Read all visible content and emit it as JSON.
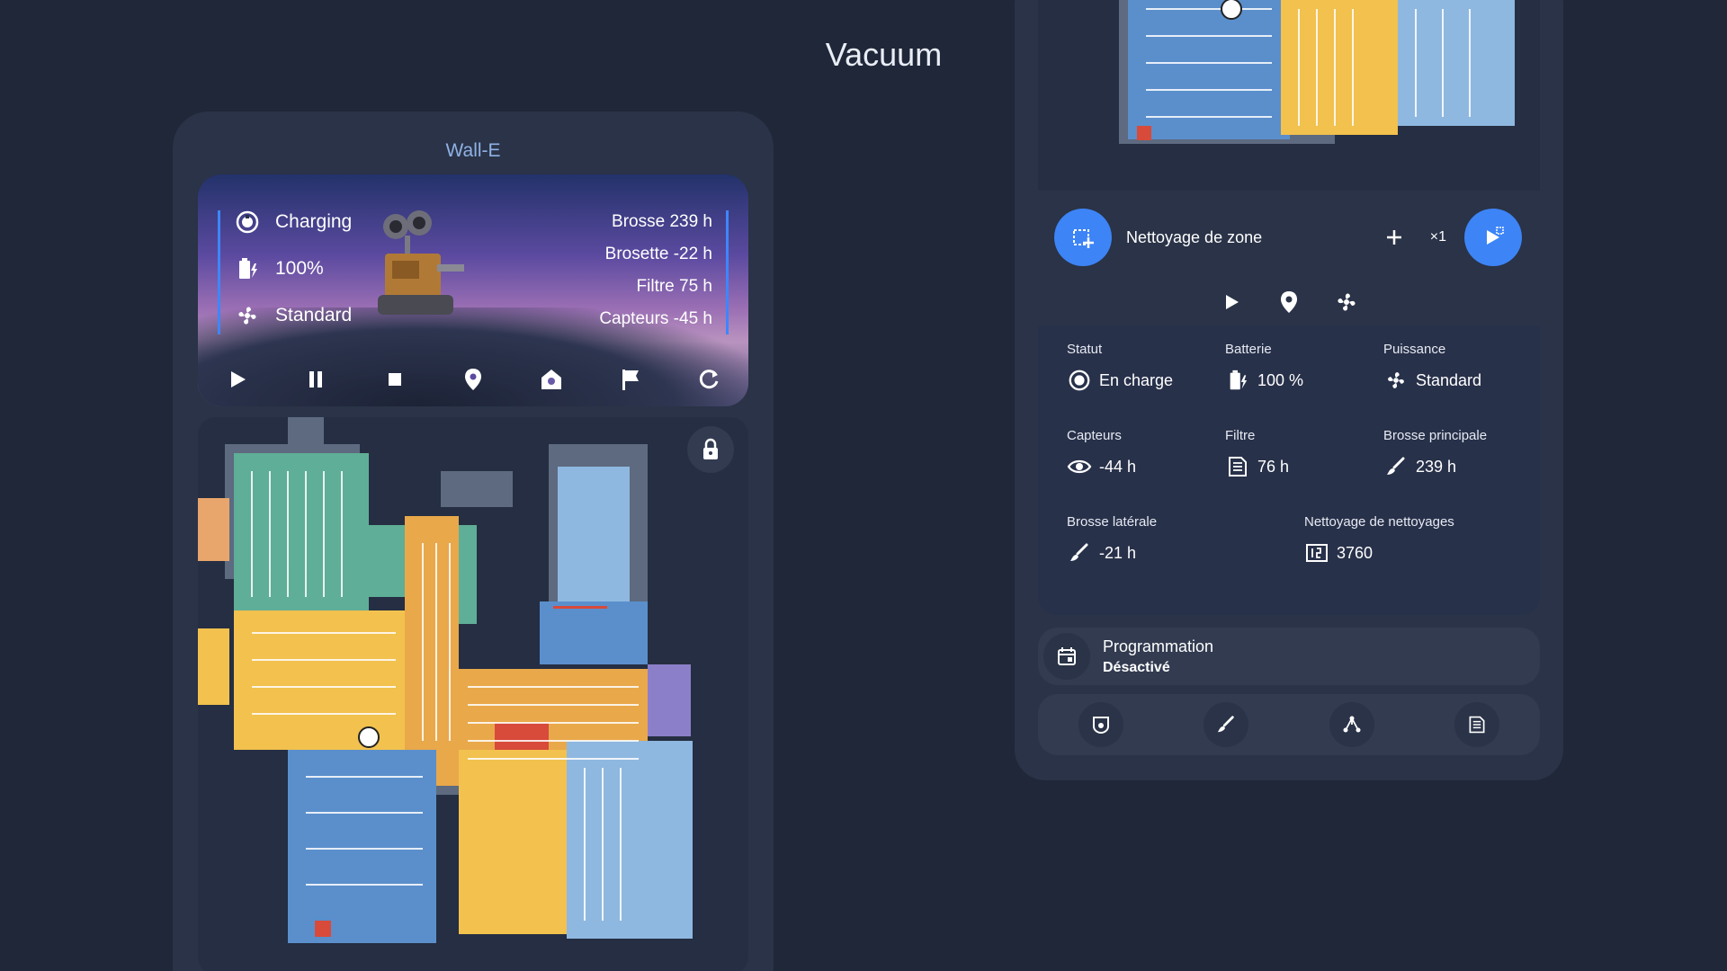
{
  "page": {
    "title": "Vacuum"
  },
  "left_card": {
    "device_name": "Wall-E",
    "status": {
      "state": "Charging",
      "battery": "100%",
      "fan": "Standard"
    },
    "consumables": [
      "Brosse 239 h",
      "Brosette -22 h",
      "Filtre 75 h",
      "Capteurs -45 h"
    ],
    "controls": [
      "play-icon",
      "pause-icon",
      "stop-icon",
      "locate-icon",
      "home-icon",
      "flag-icon",
      "refresh-icon"
    ],
    "map_lock": "lock-icon"
  },
  "right_card": {
    "zone": {
      "label": "Nettoyage de zone",
      "count": "×1"
    },
    "actions": [
      "play-icon",
      "map-pin-icon",
      "fan-icon"
    ],
    "stats": {
      "statut": {
        "label": "Statut",
        "value": "En charge"
      },
      "batterie": {
        "label": "Batterie",
        "value": "100 %"
      },
      "puissance": {
        "label": "Puissance",
        "value": "Standard"
      },
      "capteurs": {
        "label": "Capteurs",
        "value": "-44 h"
      },
      "filtre": {
        "label": "Filtre",
        "value": "76 h"
      },
      "brosse_principale": {
        "label": "Brosse principale",
        "value": "239 h"
      },
      "brosse_laterale": {
        "label": "Brosse latérale",
        "value": "-21 h"
      },
      "nettoyages": {
        "label": "Nettoyage de nettoyages",
        "value": "3760"
      }
    },
    "schedule": {
      "title": "Programmation",
      "value": "Désactivé"
    },
    "bottom_buttons": [
      "vacuum-icon",
      "brush-icon",
      "sensor-icon",
      "filter-icon"
    ]
  },
  "colors": {
    "background": "#1f2739",
    "card": "#2a3347",
    "accent": "#3d84f6",
    "room_green": "#5fae97",
    "room_yellow": "#f2c14e",
    "room_orange": "#e9a84a",
    "room_blue": "#5b8fcc",
    "room_lightblue": "#8fb8e0",
    "room_purple": "#8c7fc9"
  }
}
